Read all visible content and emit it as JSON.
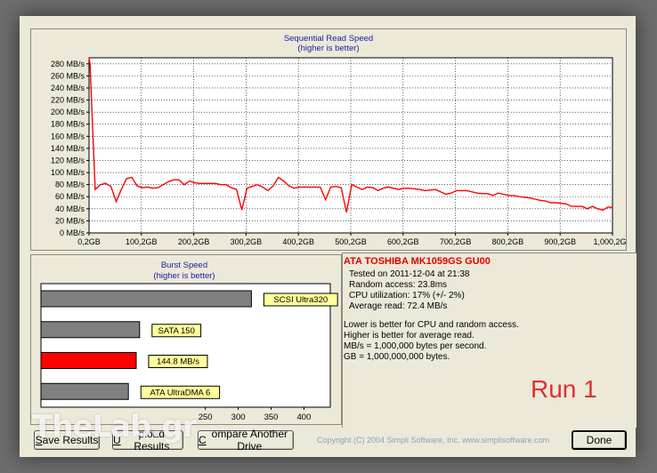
{
  "sequential": {
    "title": "Sequential Read Speed",
    "subtitle": "(higher is better)",
    "y_ticks": [
      "280 MB/s",
      "260 MB/s",
      "240 MB/s",
      "220 MB/s",
      "200 MB/s",
      "180 MB/s",
      "160 MB/s",
      "140 MB/s",
      "120 MB/s",
      "100 MB/s",
      "80 MB/s",
      "60 MB/s",
      "40 MB/s",
      "20 MB/s",
      "0 MB/s"
    ],
    "x_ticks": [
      "0,2GB",
      "100,2GB",
      "200,2GB",
      "300,2GB",
      "400,2GB",
      "500,2GB",
      "600,2GB",
      "700,2GB",
      "800,2GB",
      "900,2GB",
      "1,000,2GB"
    ],
    "line_color": "#ff0000"
  },
  "chart_data": [
    {
      "type": "line",
      "title": "Sequential Read Speed",
      "subtitle": "(higher is better)",
      "xlabel": "",
      "ylabel": "",
      "x_unit": "GB",
      "y_unit": "MB/s",
      "xlim": [
        0.2,
        1000.2
      ],
      "ylim": [
        0,
        290
      ],
      "grid": true,
      "x": [
        0.2,
        2,
        12,
        22,
        32,
        42,
        52,
        62,
        72,
        82,
        92,
        102,
        112,
        122,
        132,
        142,
        152,
        162,
        172,
        182,
        192,
        202,
        212,
        222,
        232,
        242,
        252,
        262,
        272,
        282,
        292,
        302,
        312,
        322,
        332,
        342,
        352,
        362,
        372,
        382,
        392,
        402,
        412,
        422,
        432,
        442,
        452,
        462,
        472,
        482,
        492,
        502,
        512,
        522,
        532,
        542,
        552,
        562,
        572,
        582,
        592,
        602,
        612,
        622,
        632,
        642,
        652,
        662,
        672,
        682,
        692,
        702,
        712,
        722,
        732,
        742,
        752,
        762,
        772,
        782,
        792,
        802,
        812,
        822,
        832,
        842,
        852,
        862,
        872,
        882,
        892,
        902,
        912,
        922,
        932,
        942,
        952,
        962,
        972,
        982,
        992,
        1000.2
      ],
      "y": [
        292,
        280,
        72,
        80,
        82,
        77,
        52,
        72,
        90,
        92,
        78,
        75,
        76,
        74,
        75,
        80,
        85,
        88,
        88,
        80,
        86,
        83,
        82,
        82,
        82,
        82,
        80,
        80,
        75,
        72,
        38,
        74,
        77,
        80,
        76,
        70,
        78,
        92,
        86,
        78,
        74,
        76,
        76,
        76,
        76,
        76,
        55,
        76,
        77,
        75,
        34,
        80,
        76,
        72,
        76,
        75,
        70,
        74,
        76,
        74,
        72,
        74,
        74,
        73,
        72,
        70,
        71,
        72,
        68,
        64,
        66,
        70,
        70,
        70,
        68,
        66,
        65,
        65,
        62,
        66,
        64,
        62,
        62,
        60,
        59,
        58,
        56,
        54,
        53,
        50,
        50,
        49,
        48,
        44,
        44,
        44,
        40,
        44,
        40,
        38,
        43,
        42
      ]
    },
    {
      "type": "bar",
      "title": "Burst Speed",
      "subtitle": "(higher is better)",
      "orientation": "horizontal",
      "categories": [
        "SCSI Ultra320",
        "SATA 150",
        "144.8 MB/s",
        "ATA UltraDMA 6"
      ],
      "values": [
        320,
        150,
        144.8,
        133
      ],
      "colors": [
        "#808080",
        "#808080",
        "#ff0000",
        "#808080"
      ],
      "xlim": [
        0,
        440
      ],
      "x_ticks": [
        "250",
        "300",
        "350",
        "400"
      ]
    }
  ],
  "drive": {
    "name": "ATA TOSHIBA MK1059GS GU00",
    "tested_on": "Tested on 2011-12-04 at 21:38",
    "random_access": "Random access: 23.8ms",
    "cpu": "CPU utilization: 17% (+/- 2%)",
    "average": "Average read: 72.4 MB/s"
  },
  "notes": [
    "Lower is better for CPU and random access.",
    "Higher is better for average read.",
    "MB/s = 1,000,000 bytes per second.",
    "GB = 1,000,000,000 bytes."
  ],
  "buttons": {
    "save_prefix": "S",
    "save_rest": "ave Results",
    "upload_prefix": "U",
    "upload_rest": "pload Results",
    "compare_prefix": "C",
    "compare_rest": "ompare Another Drive",
    "done": "Done"
  },
  "copyright": "Copyright (C) 2004 Simpli Software, Inc. www.simplisoftware.com",
  "run_label": "Run 1",
  "watermark": "TheLab.gr"
}
